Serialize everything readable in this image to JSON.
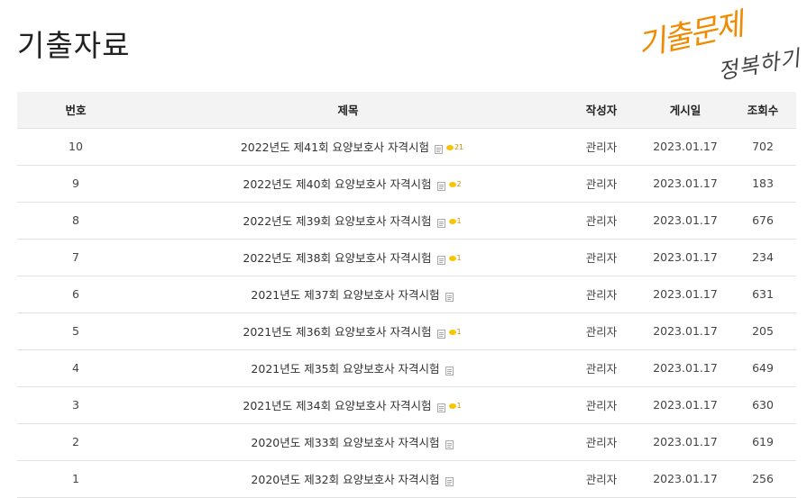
{
  "page": {
    "title": "기출자료"
  },
  "logo": {
    "line1": "기출문제",
    "line2": "정복하기",
    "color": "#f08a00"
  },
  "table": {
    "headers": {
      "no": "번호",
      "title": "제목",
      "author": "작성자",
      "date": "게시일",
      "views": "조회수"
    },
    "rows": [
      {
        "no": "10",
        "title": "2022년도 제41회 요양보호사 자격시험",
        "comments": "21",
        "author": "관리자",
        "date": "2023.01.17",
        "views": "702"
      },
      {
        "no": "9",
        "title": "2022년도 제40회 요양보호사 자격시험",
        "comments": "2",
        "author": "관리자",
        "date": "2023.01.17",
        "views": "183"
      },
      {
        "no": "8",
        "title": "2022년도 제39회 요양보호사 자격시험",
        "comments": "1",
        "author": "관리자",
        "date": "2023.01.17",
        "views": "676"
      },
      {
        "no": "7",
        "title": "2022년도 제38회 요양보호사 자격시험",
        "comments": "1",
        "author": "관리자",
        "date": "2023.01.17",
        "views": "234"
      },
      {
        "no": "6",
        "title": "2021년도 제37회 요양보호사 자격시험",
        "comments": "",
        "author": "관리자",
        "date": "2023.01.17",
        "views": "631"
      },
      {
        "no": "5",
        "title": "2021년도 제36회 요양보호사 자격시험",
        "comments": "1",
        "author": "관리자",
        "date": "2023.01.17",
        "views": "205"
      },
      {
        "no": "4",
        "title": "2021년도 제35회 요양보호사 자격시험",
        "comments": "",
        "author": "관리자",
        "date": "2023.01.17",
        "views": "649"
      },
      {
        "no": "3",
        "title": "2021년도 제34회 요양보호사 자격시험",
        "comments": "1",
        "author": "관리자",
        "date": "2023.01.17",
        "views": "630"
      },
      {
        "no": "2",
        "title": "2020년도 제33회 요양보호사 자격시험",
        "comments": "",
        "author": "관리자",
        "date": "2023.01.17",
        "views": "619"
      },
      {
        "no": "1",
        "title": "2020년도 제32회 요양보호사 자격시험",
        "comments": "",
        "author": "관리자",
        "date": "2023.01.17",
        "views": "256"
      }
    ]
  }
}
